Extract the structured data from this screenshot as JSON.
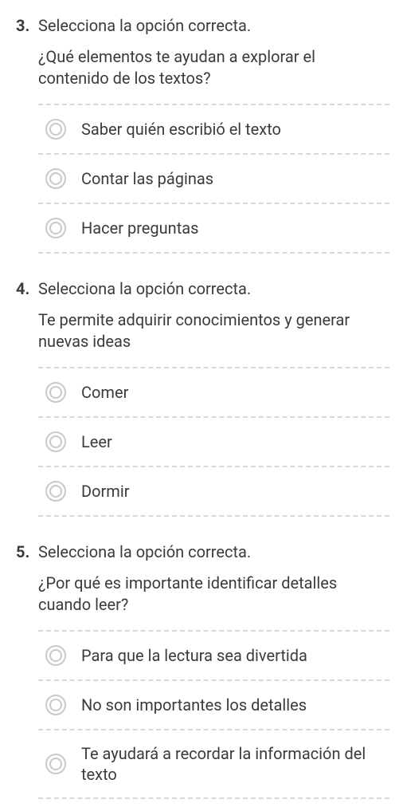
{
  "questions": [
    {
      "number": "3.",
      "instruction": "Selecciona la opción correcta.",
      "prompt": "¿Qué elementos te ayudan a explorar el contenido de los textos?",
      "options": [
        "Saber quién escribió el texto",
        "Contar las páginas",
        "Hacer preguntas"
      ]
    },
    {
      "number": "4.",
      "instruction": "Selecciona la opción correcta.",
      "prompt": "Te permite adquirir conocimientos y generar nuevas ideas",
      "options": [
        "Comer",
        "Leer",
        "Dormir"
      ]
    },
    {
      "number": "5.",
      "instruction": "Selecciona la opción correcta.",
      "prompt": "¿Por qué es importante identificar detalles cuando leer?",
      "options": [
        "Para que la lectura sea divertida",
        "No son importantes los detalles",
        "Te ayudará a recordar la información del texto"
      ]
    }
  ]
}
